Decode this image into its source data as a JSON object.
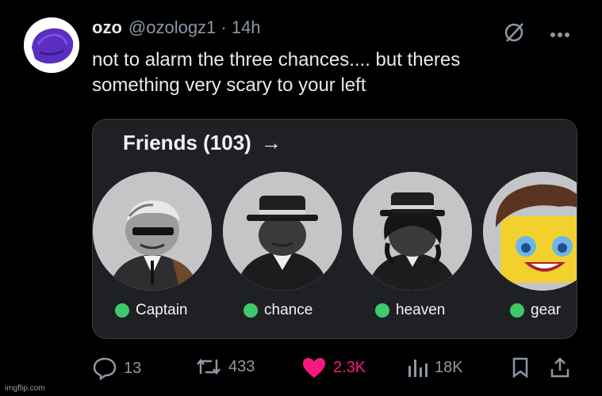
{
  "tweet": {
    "name": "ozo",
    "handle": "@ozologz1 · 14h",
    "text_lines": [
      "not to alarm the three chances.... but theres",
      "something very scary to your left"
    ]
  },
  "card": {
    "title": "Friends (103)",
    "arrow": "→",
    "friends": [
      {
        "name": "Captain"
      },
      {
        "name": "chance"
      },
      {
        "name": "heaven"
      },
      {
        "name": "gear"
      }
    ]
  },
  "actions": {
    "replies": "13",
    "retweets": "433",
    "likes": "2.3K",
    "views": "18K"
  },
  "colors": {
    "background": "#000000",
    "like": "#f91880",
    "online": "#3fc96a",
    "muted": "#8b98a5"
  },
  "watermark": "imgflip.com"
}
